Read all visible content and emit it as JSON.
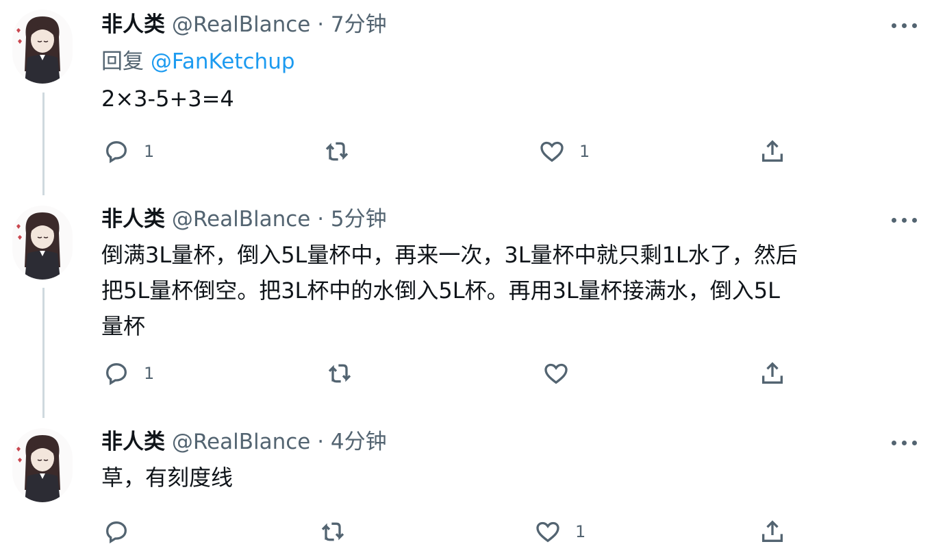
{
  "tweets": [
    {
      "name": "非人类",
      "handle": "@RealBlance",
      "separator": "·",
      "time": "7分钟",
      "reply_prefix": "回复",
      "reply_mention": "@FanKetchup",
      "text": "2×3-5+3=4",
      "reply_count": "1",
      "retweet_count": "",
      "like_count": "1"
    },
    {
      "name": "非人类",
      "handle": "@RealBlance",
      "separator": "·",
      "time": "5分钟",
      "text_lines": [
        "倒满3L量杯，倒入5L量杯中，再来一次，3L量杯中就只剩1L水了，然后",
        "把5L量杯倒空。把3L杯中的水倒入5L杯。再用3L量杯接满水，倒入5L",
        "量杯"
      ],
      "reply_count": "1",
      "retweet_count": "",
      "like_count": ""
    },
    {
      "name": "非人类",
      "handle": "@RealBlance",
      "separator": "·",
      "time": "4分钟",
      "text": "草，有刻度线",
      "reply_count": "",
      "retweet_count": "",
      "like_count": "1"
    }
  ],
  "icons": {
    "reply": "reply-icon",
    "retweet": "retweet-icon",
    "like": "heart-icon",
    "share": "share-icon",
    "more": "more-icon"
  },
  "colors": {
    "text": "#0f1419",
    "secondary": "#536471",
    "link": "#1d9bf0",
    "thread_line": "#cfd9de"
  }
}
